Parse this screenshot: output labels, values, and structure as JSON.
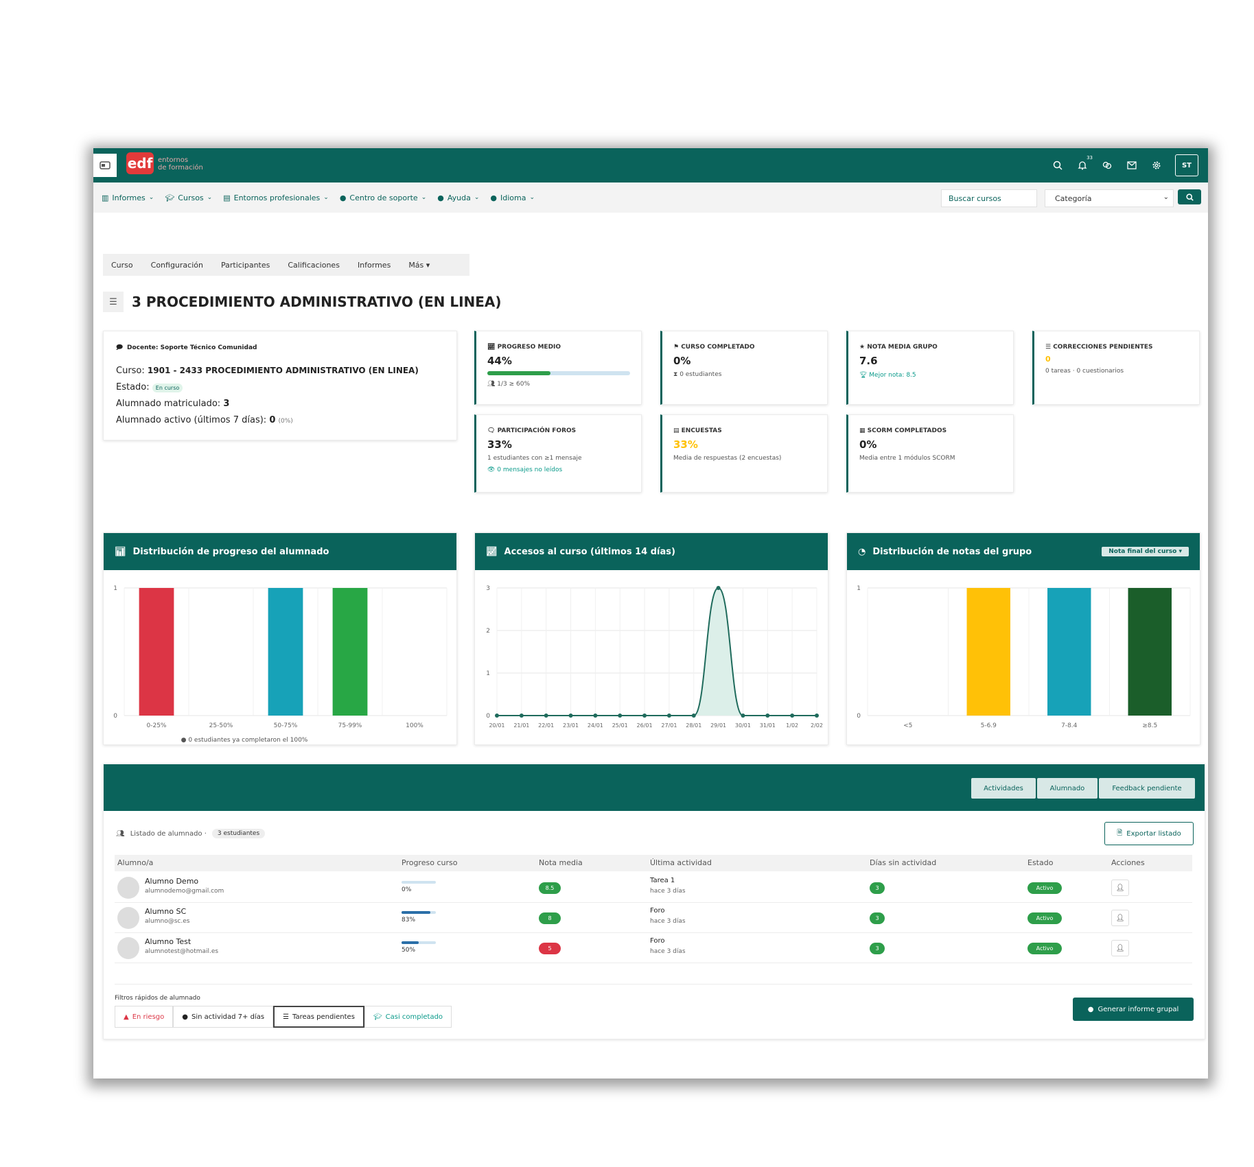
{
  "brand": {
    "logo": "edf",
    "subtitle_1": "entornos",
    "subtitle_2": "de formación"
  },
  "topbar": {
    "notif_count": "33",
    "avatar_initials": "ST"
  },
  "nav": {
    "items": [
      {
        "label": "Informes",
        "icon": "chart-icon"
      },
      {
        "label": "Cursos",
        "icon": "graduation-cap-icon"
      },
      {
        "label": "Entornos profesionales",
        "icon": "building-icon"
      },
      {
        "label": "Centro de soporte",
        "icon": "info-icon"
      },
      {
        "label": "Ayuda",
        "icon": "info-icon"
      },
      {
        "label": "Idioma",
        "icon": "globe-icon"
      }
    ],
    "search_placeholder": "Buscar cursos",
    "category_label": "Categoría"
  },
  "tabs": [
    "Curso",
    "Configuración",
    "Participantes",
    "Calificaciones",
    "Informes",
    "Más ▾"
  ],
  "page_title": "3 PROCEDIMIENTO ADMINISTRATIVO (EN LINEA)",
  "info": {
    "teacher": "Docente: Soporte Técnico Comunidad",
    "course_label": "Curso:",
    "course_value": "1901 - 2433 PROCEDIMIENTO ADMINISTRATIVO (EN LINEA)",
    "state_label": "Estado:",
    "state_value": "En curso",
    "enrolled_label": "Alumnado matriculado:",
    "enrolled_value": "3",
    "active_label": "Alumnado activo (últimos 7 días):",
    "active_value": "0",
    "active_pct": "(0%)"
  },
  "stats": [
    {
      "label": "PROGRESO MEDIO",
      "value": "44%",
      "sub": "1/3 ≥ 60%",
      "progress": 0.44
    },
    {
      "label": "CURSO COMPLETADO",
      "value": "0%",
      "sub": "0 estudiantes"
    },
    {
      "label": "NOTA MEDIA GRUPO",
      "value": "7.6",
      "sub": "Mejor nota: 8.5"
    },
    {
      "label": "CORRECCIONES PENDIENTES",
      "value": "0",
      "sub": "0 tareas · 0 cuestionarios"
    },
    {
      "label": "PARTICIPACIÓN FOROS",
      "value": "33%",
      "sub": "1 estudiantes con ≥1 mensaje",
      "sub2": "0 mensajes no leídos"
    },
    {
      "label": "ENCUESTAS",
      "value": "33%",
      "sub": "Media de respuestas (2 encuestas)"
    },
    {
      "label": "SCORM COMPLETADOS",
      "value": "0%",
      "sub": "Media entre 1 módulos SCORM"
    }
  ],
  "colors": {
    "primary": "#0a635b",
    "red": "#dc3545",
    "teal": "#17a2b8",
    "green": "#28a745",
    "yellow": "#ffc107",
    "darkgreen": "#1b5e2a"
  },
  "chart_data": [
    {
      "type": "bar",
      "title": "Distribución de progreso del alumnado",
      "categories": [
        "0-25%",
        "25-50%",
        "50-75%",
        "75-99%",
        "100%"
      ],
      "values": [
        1,
        0,
        1,
        1,
        0
      ],
      "colors": [
        "#dc3545",
        "#dc3545",
        "#17a2b8",
        "#28a745",
        "#28a745"
      ],
      "ylim": [
        0,
        1
      ],
      "yticks": [
        "0",
        "1"
      ],
      "note": "0 estudiantes ya completaron el 100%"
    },
    {
      "type": "line",
      "title": "Accesos al curso (últimos 14 días)",
      "categories": [
        "20/01",
        "21/01",
        "22/01",
        "23/01",
        "24/01",
        "25/01",
        "26/01",
        "27/01",
        "28/01",
        "29/01",
        "30/01",
        "31/01",
        "1/02",
        "2/02"
      ],
      "values": [
        0,
        0,
        0,
        0,
        0,
        0,
        0,
        0,
        0,
        3,
        0,
        0,
        0,
        0
      ],
      "ylim": [
        0,
        3
      ],
      "yticks": [
        "0",
        "1",
        "2",
        "3"
      ]
    },
    {
      "type": "bar",
      "title": "Distribución de notas del grupo",
      "selector": "Nota final del curso ▾",
      "categories": [
        "<5",
        "5-6.9",
        "7-8.4",
        "≥8.5"
      ],
      "values": [
        0,
        1,
        1,
        1
      ],
      "colors": [
        "#dc3545",
        "#ffc107",
        "#17a2b8",
        "#1b5e2a"
      ],
      "ylim": [
        0,
        1
      ],
      "yticks": [
        "0",
        "1"
      ]
    }
  ],
  "table": {
    "tabs": [
      "Actividades",
      "Alumnado",
      "Feedback pendiente"
    ],
    "list_label": "Listado de alumnado ·",
    "count": "3 estudiantes",
    "export_label": "Exportar listado",
    "columns": [
      "Alumno/a",
      "Progreso curso",
      "Nota media",
      "Última actividad",
      "Días sin actividad",
      "Estado",
      "Acciones"
    ],
    "rows": [
      {
        "name": "Alumno Demo",
        "email": "alumnodemo@gmail.com",
        "progress": "0%",
        "progress_value": 0.0,
        "grade": "8.5",
        "grade_color": "#2e9e4a",
        "activity": "Tarea 1",
        "ago": "hace 3 días",
        "days": "3",
        "state": "Activo"
      },
      {
        "name": "Alumno SC",
        "email": "alumno@sc.es",
        "progress": "83%",
        "progress_value": 0.83,
        "grade": "8",
        "grade_color": "#2e9e4a",
        "activity": "Foro",
        "ago": "hace 3 días",
        "days": "3",
        "state": "Activo"
      },
      {
        "name": "Alumno Test",
        "email": "alumnotest@hotmail.es",
        "progress": "50%",
        "progress_value": 0.5,
        "grade": "5",
        "grade_color": "#dc3545",
        "activity": "Foro",
        "ago": "hace 3 días",
        "days": "3",
        "state": "Activo"
      }
    ],
    "filters_title": "Filtros rápidos de alumnado",
    "filters": [
      {
        "label": "En riesgo",
        "color": "#dc3545"
      },
      {
        "label": "Sin actividad 7+ días",
        "color": "#333333"
      },
      {
        "label": "Tareas pendientes",
        "color": "#333333"
      },
      {
        "label": "Casi completado",
        "color": "#0a9a8a"
      }
    ],
    "report_label": "Generar informe grupal"
  }
}
